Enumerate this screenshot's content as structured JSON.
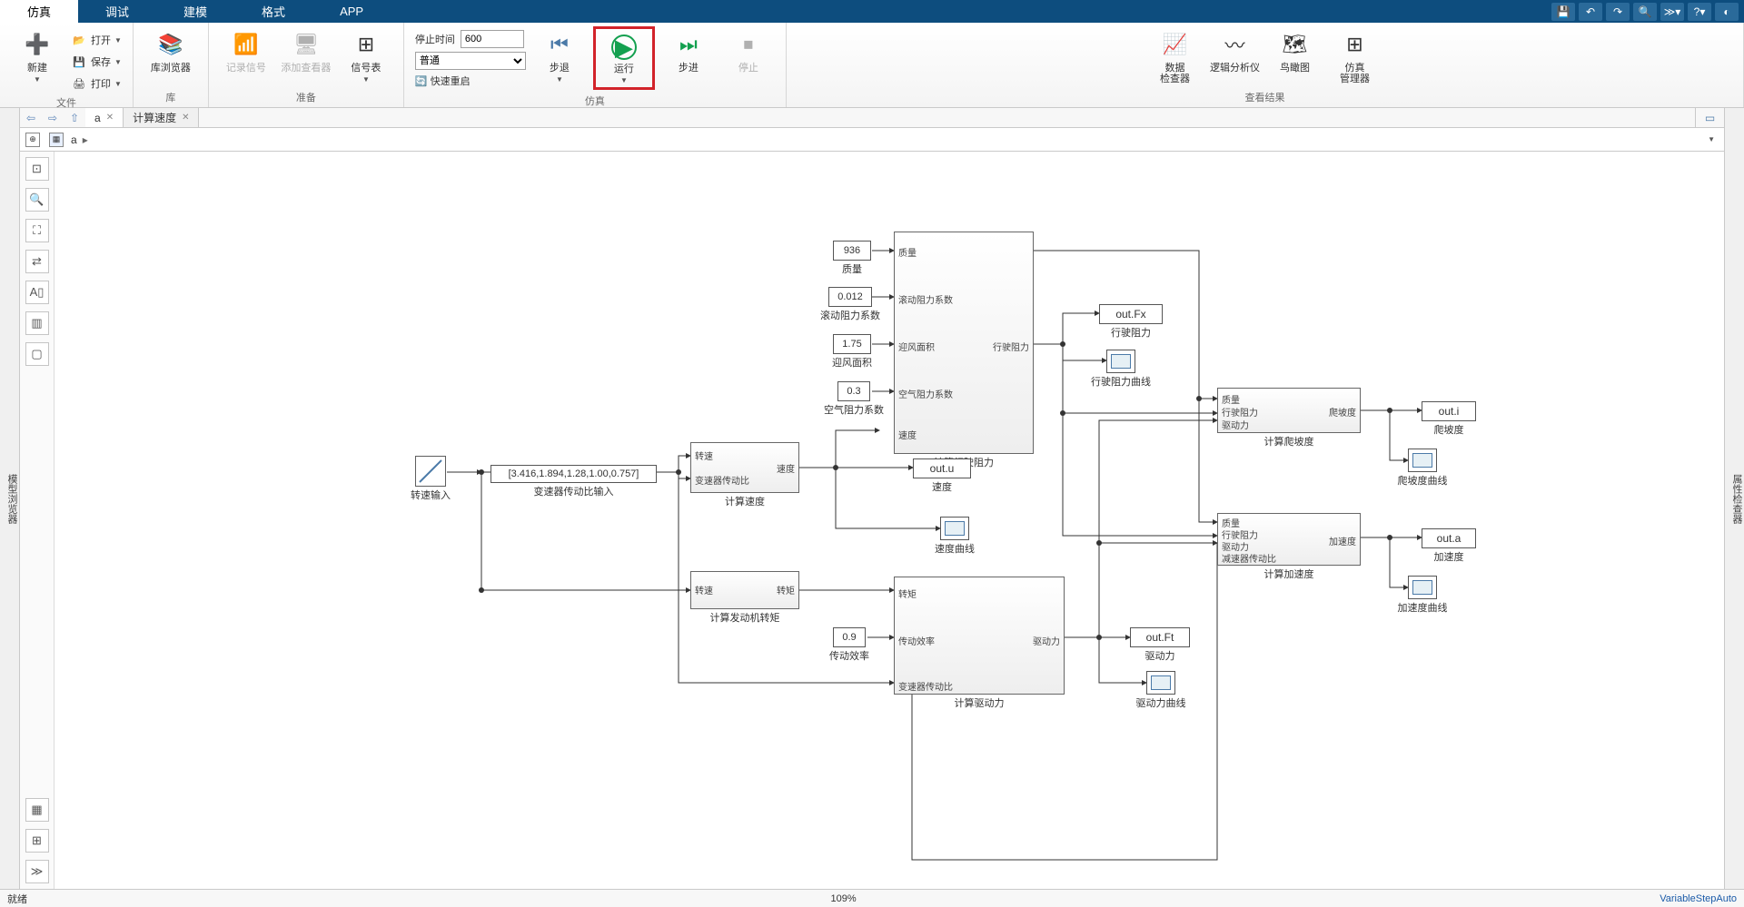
{
  "tabs": {
    "sim": "仿真",
    "debug": "调试",
    "model": "建模",
    "format": "格式",
    "app": "APP"
  },
  "ribbon": {
    "file": {
      "new": "新建",
      "open": "打开",
      "save": "保存",
      "print": "打印",
      "group": "文件"
    },
    "lib": {
      "browser": "库浏览器",
      "group": "库"
    },
    "prep": {
      "log": "记录信号",
      "viewer": "添加查看器",
      "sigtable": "信号表",
      "group": "准备"
    },
    "sim": {
      "stop_label": "停止时间",
      "stop_val": "600",
      "mode": "普通",
      "fastrestart": "快速重启",
      "stepback": "步退",
      "run": "运行",
      "stepfwd": "步进",
      "stop": "停止",
      "group": "仿真"
    },
    "review": {
      "datainspect": "数据\n检查器",
      "logic": "逻辑分析仪",
      "birdeye": "鸟瞰图",
      "simmgr": "仿真\n管理器",
      "group": "查看结果"
    }
  },
  "crumbs": {
    "tab1": "a",
    "tab2": "计算速度",
    "path_node": "a"
  },
  "panels": {
    "left": "模型浏览器",
    "right": "属性检查器"
  },
  "blocks": {
    "ramp": "转速输入",
    "gearratio": {
      "val": "[3.416,1.894,1.28,1.00,0.757]",
      "label": "变速器传动比输入"
    },
    "speed": {
      "name": "计算速度",
      "in1": "转速",
      "in2": "变速器传动比",
      "out": "速度"
    },
    "torque": {
      "name": "计算发动机转矩",
      "in": "转速",
      "out": "转矩"
    },
    "mass": {
      "val": "936",
      "label": "质量"
    },
    "roll": {
      "val": "0.012",
      "label": "滚动阻力系数"
    },
    "area": {
      "val": "1.75",
      "label": "迎风面积"
    },
    "cd": {
      "val": "0.3",
      "label": "空气阻力系数"
    },
    "eff": {
      "val": "0.9",
      "label": "传动效率"
    },
    "resist": {
      "name": "计算行驶阻力",
      "p1": "质量",
      "p2": "滚动阻力系数",
      "p3": "迎风面积",
      "p4": "空气阻力系数",
      "p5": "速度",
      "out": "行驶阻力"
    },
    "drive": {
      "name": "计算驱动力",
      "p1": "转矩",
      "p2": "传动效率",
      "p3": "变速器传动比",
      "out": "驱动力"
    },
    "grade": {
      "name": "计算爬坡度",
      "p1": "质量",
      "p2": "行驶阻力",
      "p3": "驱动力",
      "out": "爬坡度"
    },
    "accel": {
      "name": "计算加速度",
      "p1": "质量",
      "p2": "行驶阻力",
      "p3": "驱动力",
      "p4": "减速器传动比",
      "out": "加速度"
    },
    "out_fx": {
      "name": "out.Fx",
      "label": "行驶阻力"
    },
    "out_u": {
      "name": "out.u",
      "label": "速度"
    },
    "out_ft": {
      "name": "out.Ft",
      "label": "驱动力"
    },
    "out_i": {
      "name": "out.i",
      "label": "爬坡度"
    },
    "out_a": {
      "name": "out.a",
      "label": "加速度"
    },
    "scope_fx": "行驶阻力曲线",
    "scope_u": "速度曲线",
    "scope_ft": "驱动力曲线",
    "scope_i": "爬坡度曲线",
    "scope_a": "加速度曲线"
  },
  "status": {
    "ready": "就绪",
    "zoom": "109%",
    "solver": "VariableStepAuto"
  }
}
